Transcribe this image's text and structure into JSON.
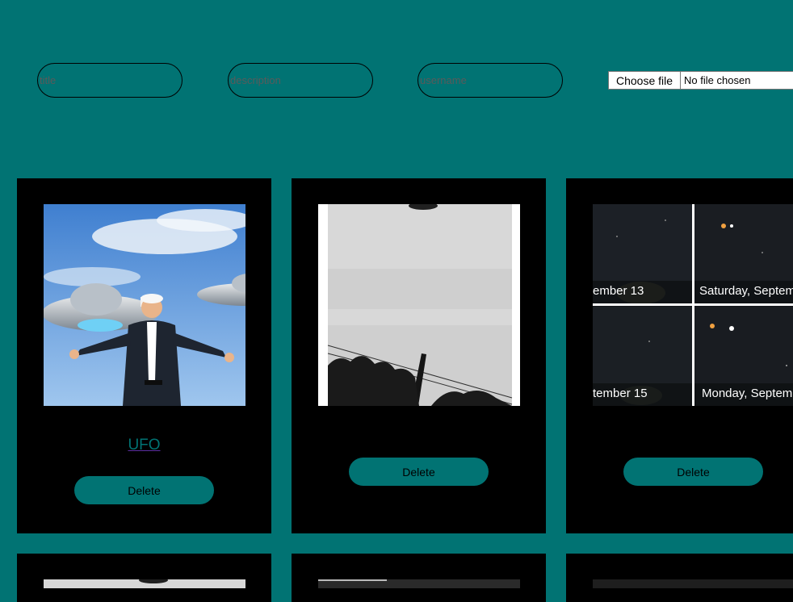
{
  "form": {
    "title_placeholder": "title",
    "description_placeholder": "description",
    "username_placeholder": "username",
    "file_button_label": "Choose file",
    "file_status": "No file chosen"
  },
  "posts": [
    {
      "title": "UFO",
      "delete_label": "Delete",
      "image": "trump-with-flying-saucers-photo"
    },
    {
      "title": "",
      "delete_label": "Delete",
      "image": "grainy-black-white-ufo-photo"
    },
    {
      "title": "",
      "delete_label": "Delete",
      "image": "night-sky-planets-collage-photo"
    }
  ],
  "collage_labels": {
    "top_left": "ember 13",
    "top_right": "Saturday, Septem",
    "bottom_left": "tember 15",
    "bottom_right": "Monday, Septem"
  },
  "colors": {
    "background": "#017373",
    "card": "#000000",
    "button": "#017373",
    "link_underline": "#5a2fa0"
  }
}
